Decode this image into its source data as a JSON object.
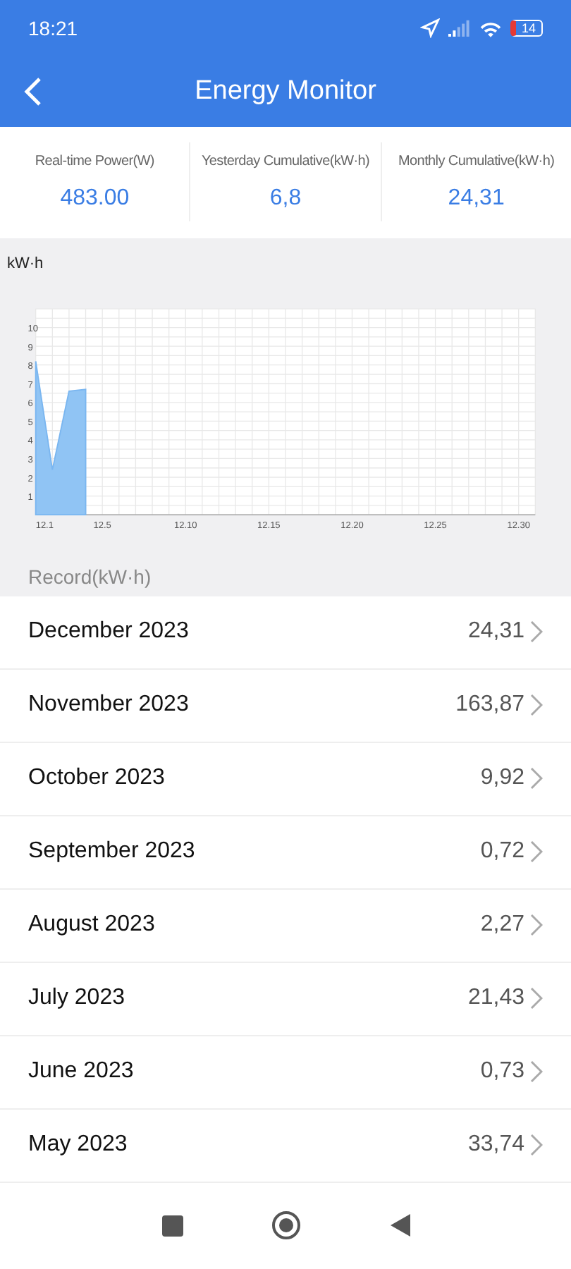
{
  "status_bar": {
    "time": "18:21",
    "battery": "14"
  },
  "header": {
    "title": "Energy Monitor"
  },
  "stats": [
    {
      "label": "Real-time Power(W)",
      "value": "483.00"
    },
    {
      "label": "Yesterday Cumulative(kW·h)",
      "value": "6,8"
    },
    {
      "label": "Monthly Cumulative(kW·h)",
      "value": "24,31"
    }
  ],
  "chart": {
    "unit": "kW·h",
    "chart_data": {
      "type": "area",
      "categories": [
        "12.1",
        null,
        null,
        null,
        "12.5",
        null,
        null,
        null,
        null,
        "12.10",
        null,
        null,
        null,
        null,
        "12.15",
        null,
        null,
        null,
        null,
        "12.20",
        null,
        null,
        null,
        null,
        "12.25",
        null,
        null,
        null,
        null,
        "12.30",
        null
      ],
      "series": [
        {
          "color": "#90c4f4",
          "values": [
            8.2,
            2.4,
            6.6,
            6.7,
            null,
            null,
            null,
            null,
            null,
            null,
            null,
            null,
            null,
            null,
            null,
            null,
            null,
            null,
            null,
            null,
            null,
            null,
            null,
            null,
            null,
            null,
            null,
            null,
            null,
            null,
            null
          ]
        }
      ],
      "ylim": [
        0,
        11
      ],
      "yticks": [
        1,
        2,
        3,
        4,
        5,
        6,
        7,
        8,
        9,
        10
      ],
      "grid": true
    }
  },
  "records": {
    "title": "Record(kW·h)",
    "rows": [
      {
        "month": "December 2023",
        "value": "24,31"
      },
      {
        "month": "November 2023",
        "value": "163,87"
      },
      {
        "month": "October 2023",
        "value": "9,92"
      },
      {
        "month": "September 2023",
        "value": "0,72"
      },
      {
        "month": "August 2023",
        "value": "2,27"
      },
      {
        "month": "July 2023",
        "value": "21,43"
      },
      {
        "month": "June 2023",
        "value": "0,73"
      },
      {
        "month": "May 2023",
        "value": "33,74"
      }
    ]
  }
}
